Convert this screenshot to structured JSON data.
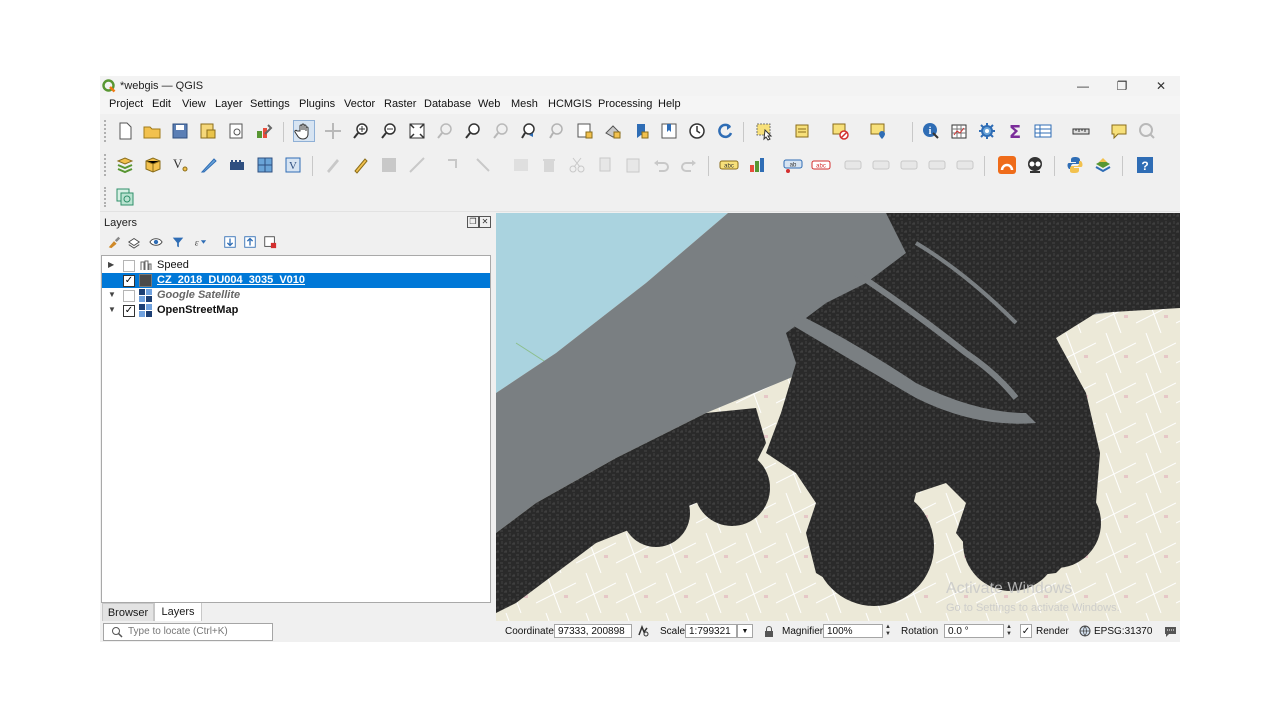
{
  "window": {
    "title": "*webgis — QGIS",
    "controls": {
      "minimize": "—",
      "restore": "❐",
      "close": "✕"
    }
  },
  "menu": [
    "Project",
    "Edit",
    "View",
    "Layer",
    "Settings",
    "Plugins",
    "Vector",
    "Raster",
    "Database",
    "Web",
    "Mesh",
    "HCMGIS",
    "Processing",
    "Help"
  ],
  "layers_panel": {
    "title": "Layers",
    "layers": [
      {
        "name": "Speed",
        "checked": false,
        "expanded": false,
        "style": "normal",
        "icon": "vector-layer-icon"
      },
      {
        "name": "CZ_2018_DU004_3035_V010",
        "checked": true,
        "expanded": false,
        "style": "selected",
        "icon": "polygon-layer-icon"
      },
      {
        "name": "Google Satellite",
        "checked": false,
        "expanded": true,
        "style": "italic",
        "icon": "raster-tile-icon"
      },
      {
        "name": "OpenStreetMap",
        "checked": true,
        "expanded": true,
        "style": "bold",
        "icon": "raster-tile-icon"
      }
    ],
    "tabs": {
      "browser": "Browser",
      "layers": "Layers"
    }
  },
  "statusbar": {
    "locate_placeholder": "Type to locate (Ctrl+K)",
    "coordinate_label": "Coordinate",
    "coordinate_value": "97333, 200898",
    "scale_label": "Scale",
    "scale_value": "1:799321",
    "magnifier_label": "Magnifier",
    "magnifier_value": "100%",
    "rotation_label": "Rotation",
    "rotation_value": "0.0 °",
    "render_label": "Render",
    "render_checked": true,
    "crs": "EPSG:31370"
  },
  "watermark": {
    "line1": "Activate Windows",
    "line2": "Go to Settings to activate Windows."
  },
  "colors": {
    "selection": "#0078d7",
    "sea": "#aad3df",
    "land": "#ece9d8",
    "dark_layer": "#2a2a2a",
    "water_overlay": "#7a7f82"
  }
}
